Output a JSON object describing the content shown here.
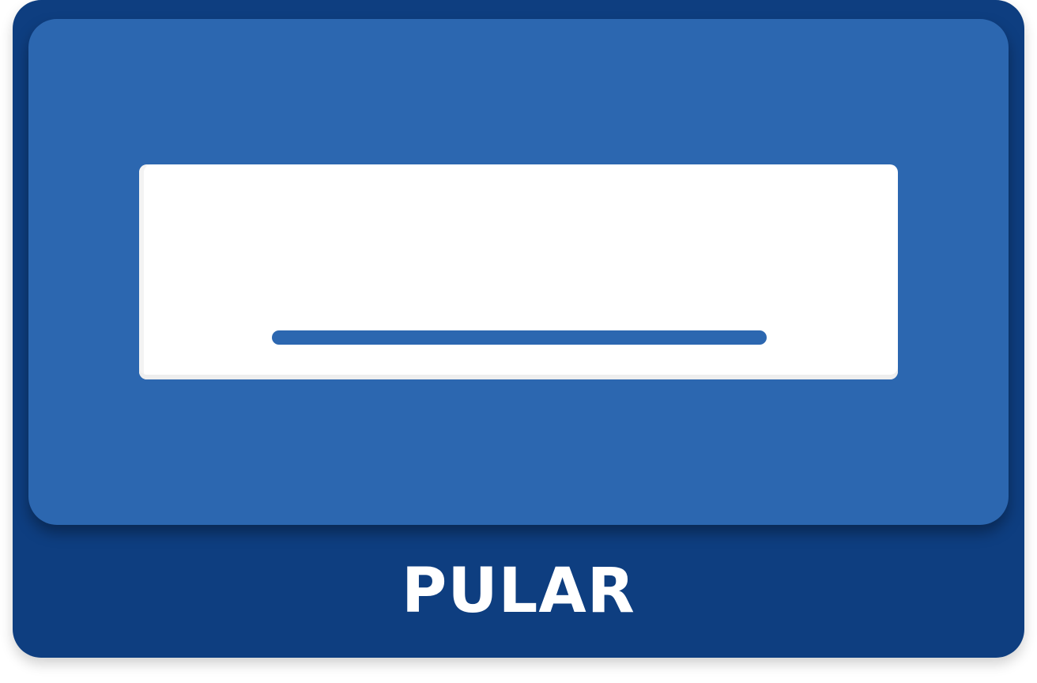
{
  "button": {
    "label": "PULAR",
    "icon": "air-conditioner-icon"
  },
  "colors": {
    "frame": "#0e3e80",
    "panel": "#2c67b0",
    "tile": "#ffffff",
    "accent_bar": "#2c67b0",
    "label_text": "#ffffff"
  }
}
